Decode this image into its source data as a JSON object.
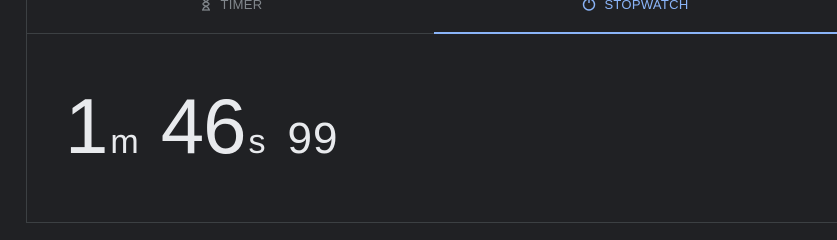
{
  "tabs": {
    "timer": {
      "label": "TIMER",
      "icon": "hourglass-icon"
    },
    "stopwatch": {
      "label": "STOPWATCH",
      "icon": "stopwatch-icon",
      "selected": true
    }
  },
  "stopwatch": {
    "minutes": "1",
    "minutes_unit": "m",
    "seconds": "46",
    "seconds_unit": "s",
    "hundredths": "99"
  },
  "colors": {
    "background": "#202124",
    "accent": "#8ab4f8",
    "text": "#e8eaed",
    "muted": "#80868b",
    "divider": "#3c4043"
  }
}
